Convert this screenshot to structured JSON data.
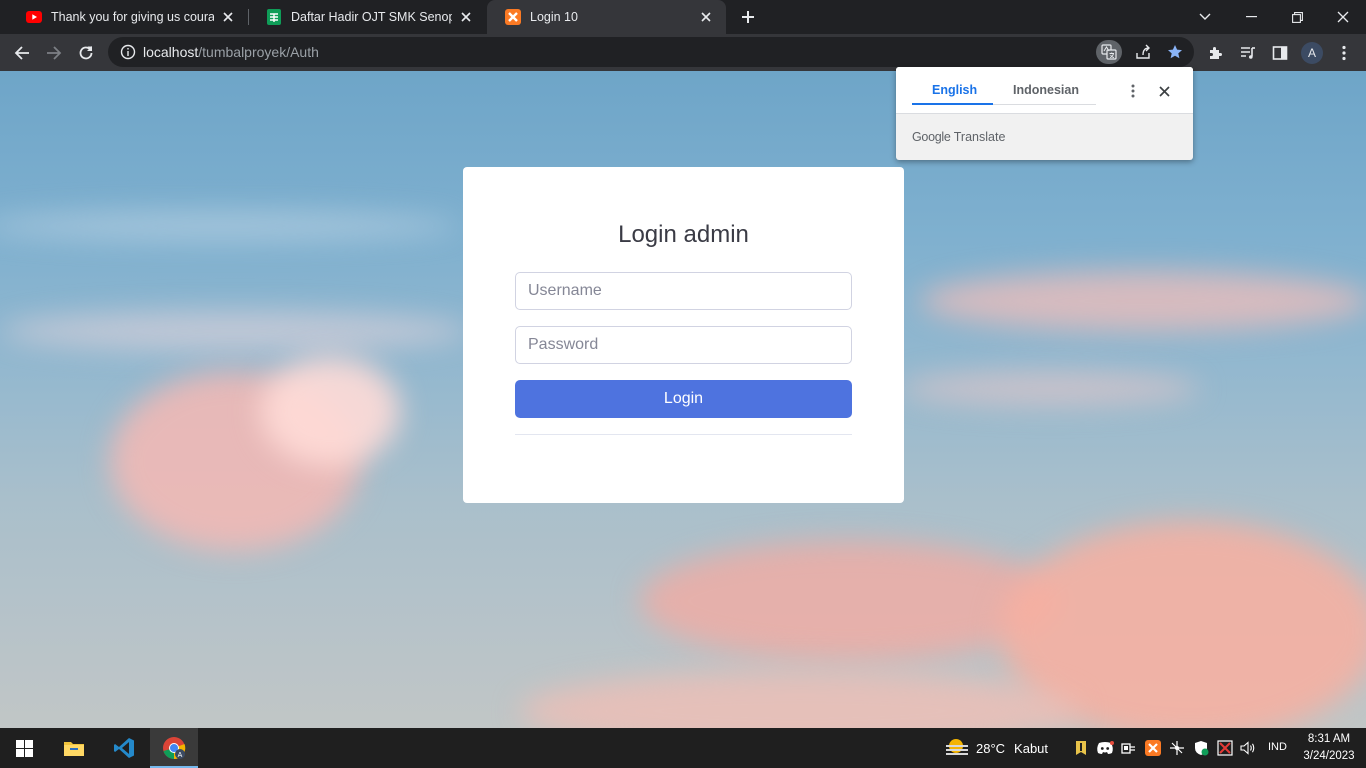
{
  "browser": {
    "tabs": [
      {
        "title": "Thank you for giving us courage,",
        "favicon": "youtube-icon",
        "active": false
      },
      {
        "title": "Daftar Hadir OJT SMK Senopati A",
        "favicon": "google-sheets-icon",
        "active": false
      },
      {
        "title": "Login 10",
        "favicon": "xampp-icon",
        "active": true
      }
    ],
    "url_host": "localhost",
    "url_path": "/tumbalproyek/Auth",
    "avatar_letter": "A"
  },
  "translate_popup": {
    "tab_english": "English",
    "tab_indonesian": "Indonesian",
    "footer_brand": "Google",
    "footer_text": "Translate"
  },
  "login": {
    "title": "Login admin",
    "username_placeholder": "Username",
    "password_placeholder": "Password",
    "button_label": "Login"
  },
  "taskbar": {
    "weather_temp": "28°C",
    "weather_desc": "Kabut",
    "language": "IND",
    "time": "8:31 AM",
    "date": "3/24/2023"
  },
  "colors": {
    "accent_button": "#4e73df",
    "chrome_dark": "#202124",
    "chrome_toolbar": "#35363a",
    "bookmark_star": "#8ab4f8",
    "translate_tab_active": "#1a73e8"
  }
}
